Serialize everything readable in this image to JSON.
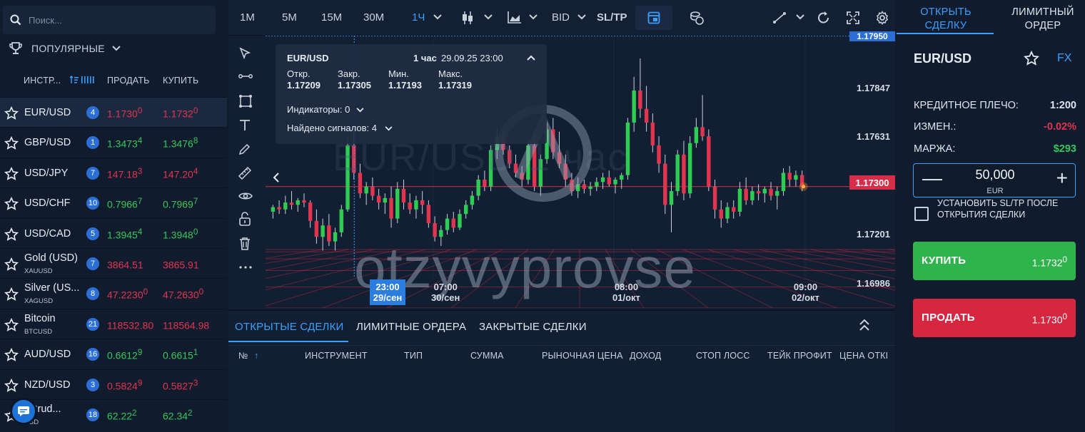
{
  "colors": {
    "accent": "#3aa0ff",
    "up": "#35c759",
    "down": "#e1354f",
    "badge": "#2b6fd6"
  },
  "search": {
    "placeholder": "Поиск..."
  },
  "popular": {
    "label": "ПОПУЛЯРНЫЕ"
  },
  "list_header": {
    "instrument": "ИНСТР...",
    "sell": "ПРОДАТЬ",
    "buy": "КУПИТЬ"
  },
  "instruments": [
    {
      "name": "EUR/USD",
      "sub": "",
      "count": "4",
      "sell": "1.1730",
      "sell_sup": "0",
      "buy": "1.1732",
      "buy_sup": "0",
      "sell_color": "red",
      "buy_color": "red",
      "active": true
    },
    {
      "name": "GBP/USD",
      "sub": "",
      "count": "1",
      "sell": "1.3473",
      "sell_sup": "4",
      "buy": "1.3476",
      "buy_sup": "8",
      "sell_color": "green",
      "buy_color": "green"
    },
    {
      "name": "USD/JPY",
      "sub": "",
      "count": "7",
      "sell": "147.18",
      "sell_sup": "3",
      "buy": "147.20",
      "buy_sup": "4",
      "sell_color": "red",
      "buy_color": "red"
    },
    {
      "name": "USD/CHF",
      "sub": "",
      "count": "10",
      "sell": "0.7966",
      "sell_sup": "7",
      "buy": "0.7969",
      "buy_sup": "7",
      "sell_color": "green",
      "buy_color": "green"
    },
    {
      "name": "USD/CAD",
      "sub": "",
      "count": "5",
      "sell": "1.3945",
      "sell_sup": "4",
      "buy": "1.3948",
      "buy_sup": "0",
      "sell_color": "green",
      "buy_color": "green"
    },
    {
      "name": "Gold (USD)",
      "sub": "XAUUSD",
      "count": "7",
      "sell": "3864.51",
      "sell_sup": "",
      "buy": "3865.91",
      "buy_sup": "",
      "sell_color": "red",
      "buy_color": "red"
    },
    {
      "name": "Silver (US...",
      "sub": "XAGUSD",
      "count": "8",
      "sell": "47.2230",
      "sell_sup": "0",
      "buy": "47.2630",
      "buy_sup": "0",
      "sell_color": "red",
      "buy_color": "red"
    },
    {
      "name": "Bitcoin",
      "sub": "BTCUSD",
      "count": "21",
      "sell": "118532.80",
      "sell_sup": "",
      "buy": "118564.98",
      "buy_sup": "",
      "sell_color": "red",
      "buy_color": "red"
    },
    {
      "name": "AUD/USD",
      "sub": "",
      "count": "16",
      "sell": "0.6612",
      "sell_sup": "9",
      "buy": "0.6615",
      "buy_sup": "1",
      "sell_color": "green",
      "buy_color": "green"
    },
    {
      "name": "NZD/USD",
      "sub": "",
      "count": "3",
      "sell": "0.5824",
      "sell_sup": "9",
      "buy": "0.5827",
      "buy_sup": "3",
      "sell_color": "red",
      "buy_color": "red"
    },
    {
      "name": ". Crud...",
      "sub": "USD",
      "count": "18",
      "sell": "62.22",
      "sell_sup": "2",
      "buy": "62.34",
      "buy_sup": "2",
      "sell_color": "green",
      "buy_color": "green"
    }
  ],
  "toolbar": {
    "timeframes": [
      "1M",
      "5M",
      "15M",
      "30M",
      "1Ч"
    ],
    "active_timeframe": "1Ч",
    "price_type": "BID",
    "sltp": "SL/TP"
  },
  "infobox": {
    "symbol": "EUR/USD",
    "period": "1 час",
    "datetime": "29.09.25 23:00",
    "open_label": "Откр.",
    "open": "1.17209",
    "close_label": "Закр.",
    "close": "1.17305",
    "low_label": "Мин.",
    "low": "1.17193",
    "high_label": "Макс.",
    "high": "1.17319",
    "indicators": "Индикаторы: 0",
    "signals": "Найдено сигналов: 4"
  },
  "watermark": {
    "bg_text": "EUR/USD 1 час",
    "text": "otzyvyprovse"
  },
  "chart_data": {
    "type": "candlestick",
    "price_labels": [
      "1.17950",
      "1.17847",
      "1.17631",
      "1.17300",
      "1.17201",
      "1.16986"
    ],
    "current_price": "1.17300",
    "time_labels": [
      {
        "time": "23:00",
        "date": "29/сен",
        "highlight": true
      },
      {
        "time": "07:00",
        "date": "30/сен"
      },
      {
        "time": "08:00",
        "date": "01/окт"
      },
      {
        "time": "09:00",
        "date": "02/окт"
      }
    ],
    "ylim": [
      1.169,
      1.1796
    ],
    "candles": [
      [
        1.1719,
        1.1722,
        1.1716,
        1.1721
      ],
      [
        1.1721,
        1.1724,
        1.1718,
        1.172
      ],
      [
        1.172,
        1.1726,
        1.1718,
        1.1723
      ],
      [
        1.1723,
        1.1728,
        1.172,
        1.1722
      ],
      [
        1.1722,
        1.1725,
        1.1719,
        1.1724
      ],
      [
        1.1724,
        1.1727,
        1.1721,
        1.1723
      ],
      [
        1.1723,
        1.1724,
        1.1712,
        1.1715
      ],
      [
        1.1715,
        1.172,
        1.1705,
        1.1708
      ],
      [
        1.1708,
        1.1716,
        1.1702,
        1.1713
      ],
      [
        1.1713,
        1.1718,
        1.1704,
        1.1706
      ],
      [
        1.1706,
        1.1712,
        1.1702,
        1.171
      ],
      [
        1.171,
        1.1722,
        1.1708,
        1.172
      ],
      [
        1.172,
        1.1752,
        1.1719,
        1.1748
      ],
      [
        1.1748,
        1.1756,
        1.1733,
        1.1736
      ],
      [
        1.1736,
        1.174,
        1.1725,
        1.1727
      ],
      [
        1.1727,
        1.1732,
        1.1722,
        1.173
      ],
      [
        1.173,
        1.1734,
        1.1724,
        1.1726
      ],
      [
        1.1726,
        1.1729,
        1.172,
        1.1723
      ],
      [
        1.1723,
        1.1727,
        1.1718,
        1.1725
      ],
      [
        1.1725,
        1.173,
        1.1712,
        1.1716
      ],
      [
        1.1716,
        1.1732,
        1.1714,
        1.1729
      ],
      [
        1.1729,
        1.1733,
        1.172,
        1.1723
      ],
      [
        1.1723,
        1.1727,
        1.1718,
        1.172
      ],
      [
        1.172,
        1.1726,
        1.1716,
        1.1724
      ],
      [
        1.1724,
        1.1728,
        1.1718,
        1.1722
      ],
      [
        1.1722,
        1.1724,
        1.1712,
        1.1714
      ],
      [
        1.1714,
        1.1717,
        1.1706,
        1.1708
      ],
      [
        1.1708,
        1.1713,
        1.1704,
        1.1711
      ],
      [
        1.1711,
        1.1718,
        1.1709,
        1.1716
      ],
      [
        1.1716,
        1.1719,
        1.171,
        1.1712
      ],
      [
        1.1712,
        1.172,
        1.1711,
        1.1718
      ],
      [
        1.1718,
        1.1724,
        1.1716,
        1.1722
      ],
      [
        1.1722,
        1.1728,
        1.172,
        1.1726
      ],
      [
        1.1726,
        1.1735,
        1.1724,
        1.1733
      ],
      [
        1.1733,
        1.1737,
        1.1728,
        1.173
      ],
      [
        1.173,
        1.1748,
        1.1728,
        1.1746
      ],
      [
        1.1746,
        1.1756,
        1.1742,
        1.1752
      ],
      [
        1.1752,
        1.1755,
        1.1744,
        1.1746
      ],
      [
        1.1746,
        1.1748,
        1.1738,
        1.174
      ],
      [
        1.174,
        1.1744,
        1.1734,
        1.1736
      ],
      [
        1.1736,
        1.1739,
        1.173,
        1.1733
      ],
      [
        1.1733,
        1.175,
        1.1731,
        1.1748
      ],
      [
        1.1748,
        1.1754,
        1.1728,
        1.173
      ],
      [
        1.173,
        1.1744,
        1.1726,
        1.1742
      ],
      [
        1.1742,
        1.1758,
        1.174,
        1.1755
      ],
      [
        1.1755,
        1.176,
        1.1742,
        1.1745
      ],
      [
        1.1745,
        1.1754,
        1.1738,
        1.174
      ],
      [
        1.174,
        1.1744,
        1.173,
        1.1733
      ],
      [
        1.1733,
        1.1736,
        1.1726,
        1.1728
      ],
      [
        1.1728,
        1.1734,
        1.1725,
        1.1731
      ],
      [
        1.1731,
        1.1733,
        1.1727,
        1.1729
      ],
      [
        1.1729,
        1.1732,
        1.1726,
        1.173
      ],
      [
        1.173,
        1.1734,
        1.1728,
        1.1732
      ],
      [
        1.1732,
        1.1736,
        1.1729,
        1.1734
      ],
      [
        1.1734,
        1.1737,
        1.173,
        1.1731
      ],
      [
        1.1731,
        1.1734,
        1.1727,
        1.1733
      ],
      [
        1.1733,
        1.1736,
        1.1729,
        1.1735
      ],
      [
        1.1735,
        1.176,
        1.1733,
        1.1758
      ],
      [
        1.1758,
        1.1778,
        1.1754,
        1.1772
      ],
      [
        1.1772,
        1.1786,
        1.176,
        1.1764
      ],
      [
        1.1764,
        1.1774,
        1.1754,
        1.1758
      ],
      [
        1.1758,
        1.1762,
        1.1745,
        1.1748
      ],
      [
        1.1748,
        1.1752,
        1.1736,
        1.174
      ],
      [
        1.174,
        1.1744,
        1.1718,
        1.1722
      ],
      [
        1.1722,
        1.1732,
        1.171,
        1.1728
      ],
      [
        1.1728,
        1.1746,
        1.1726,
        1.1744
      ],
      [
        1.1744,
        1.175,
        1.1724,
        1.1727
      ],
      [
        1.1727,
        1.1752,
        1.1725,
        1.1749
      ],
      [
        1.1749,
        1.176,
        1.1747,
        1.1756
      ],
      [
        1.1756,
        1.177,
        1.175,
        1.1752
      ],
      [
        1.1752,
        1.1755,
        1.1728,
        1.173
      ],
      [
        1.173,
        1.1733,
        1.1716,
        1.172
      ],
      [
        1.172,
        1.1724,
        1.1712,
        1.1716
      ],
      [
        1.1716,
        1.1723,
        1.1714,
        1.1721
      ],
      [
        1.1721,
        1.1724,
        1.1716,
        1.1719
      ],
      [
        1.1719,
        1.1732,
        1.1717,
        1.1729
      ],
      [
        1.1729,
        1.1734,
        1.1722,
        1.1724
      ],
      [
        1.1724,
        1.173,
        1.1722,
        1.1728
      ],
      [
        1.1728,
        1.1731,
        1.1724,
        1.1727
      ],
      [
        1.1727,
        1.173,
        1.1723,
        1.1729
      ],
      [
        1.1729,
        1.1732,
        1.1724,
        1.1726
      ],
      [
        1.1726,
        1.173,
        1.172,
        1.1728
      ],
      [
        1.1728,
        1.1738,
        1.1726,
        1.1736
      ],
      [
        1.1736,
        1.1739,
        1.173,
        1.1733
      ],
      [
        1.1733,
        1.1737,
        1.173,
        1.1735
      ],
      [
        1.1735,
        1.1737,
        1.1728,
        1.173
      ]
    ]
  },
  "bottom": {
    "tabs": [
      "ОТКРЫТЫЕ СДЕЛКИ",
      "ЛИМИТНЫЕ ОРДЕРА",
      "ЗАКРЫТЫЕ СДЕЛКИ"
    ],
    "columns": [
      "№",
      "ИНСТРУМЕНТ",
      "ТИП",
      "СУММА",
      "РЫНОЧНАЯ ЦЕНА",
      "ДОХОД",
      "СТОП ЛОСС",
      "ТЕЙК ПРОФИТ",
      "ЦЕНА ОТКІ"
    ]
  },
  "right": {
    "tab_open": "ОТКРЫТЬ СДЕЛКУ",
    "tab_limit": "ЛИМИТНЫЙ ОРДЕР",
    "symbol": "EUR/USD",
    "fx": "FX",
    "leverage_label": "КРЕДИТНОЕ ПЛЕЧО:",
    "leverage": "1:200",
    "change_label": "ИЗМЕН.:",
    "change": "-0.02%",
    "margin_label": "МАРЖА:",
    "margin": "$293",
    "amount": "50,000",
    "currency": "EUR",
    "sltp_label": "УСТАНОВИТЬ SL/TP ПОСЛЕ ОТКРЫТИЯ СДЕЛКИ",
    "buy_label": "КУПИТЬ",
    "buy_price": "1.1732",
    "buy_sup": "0",
    "sell_label": "ПРОДАТЬ",
    "sell_price": "1.1730",
    "sell_sup": "0"
  }
}
